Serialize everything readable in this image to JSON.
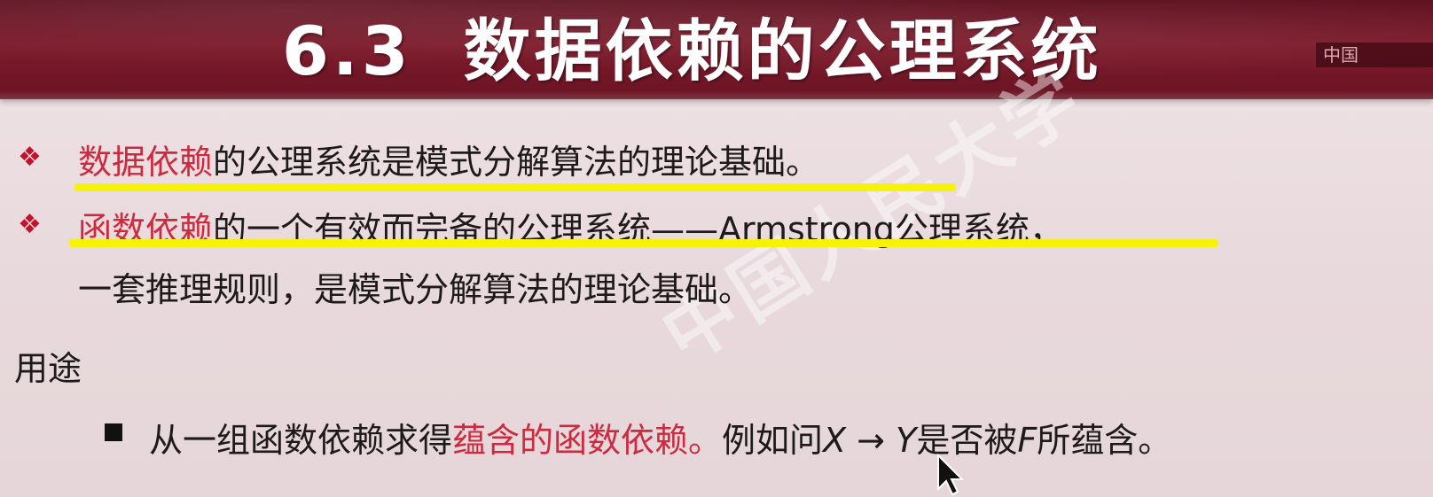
{
  "title": {
    "number": "6.3",
    "text": "数据依赖的公理系统"
  },
  "logo_text": "中国",
  "watermark_text": "中国人民大学",
  "bullets": [
    {
      "highlight": "数据依赖",
      "rest": "的公理系统是模式分解算法的理论基础。"
    },
    {
      "highlight": "函数依赖",
      "rest": "的一个有效而完备的公理系统——Armstrong公理系统，",
      "continuation": "一套推理规则，是模式分解算法的理论基础。"
    }
  ],
  "section_label": "用途",
  "sub_item": {
    "part1": "从一组函数依赖求得",
    "red": "蕴含的函数依赖。",
    "part2": "例如问",
    "x": "X",
    "arrow": " → ",
    "y": "Y",
    "part3": "是否被",
    "f": "F",
    "part4": "所蕴含。"
  },
  "colors": {
    "title_bar": "#6a1424",
    "accent_red": "#cc2a3e",
    "highlight_yellow": "#f7f20a",
    "background": "#e9dadd"
  }
}
